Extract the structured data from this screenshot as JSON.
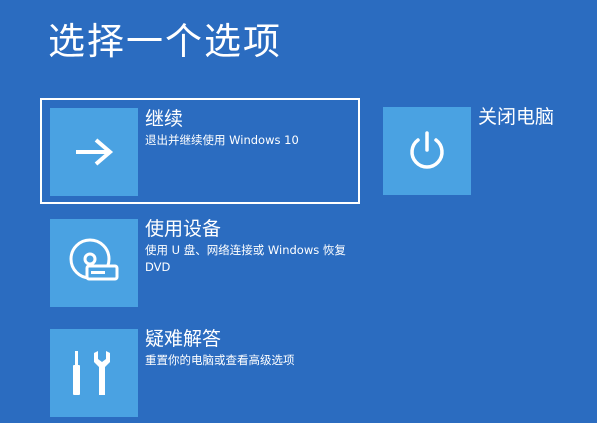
{
  "screen": {
    "title": "选择一个选项"
  },
  "options": {
    "continue": {
      "label": "继续",
      "desc": "退出并继续使用 Windows 10",
      "icon": "arrow-right-icon"
    },
    "use_device": {
      "label": "使用设备",
      "desc": "使用 U 盘、网络连接或 Windows 恢复 DVD",
      "icon": "disc-drive-icon"
    },
    "troubleshoot": {
      "label": "疑难解答",
      "desc": "重置你的电脑或查看高级选项",
      "icon": "tools-icon"
    },
    "shutdown": {
      "label": "关闭电脑",
      "icon": "power-icon"
    }
  },
  "colors": {
    "background": "#2b6cc0",
    "tile": "#4aa2e2",
    "text": "#ffffff"
  }
}
